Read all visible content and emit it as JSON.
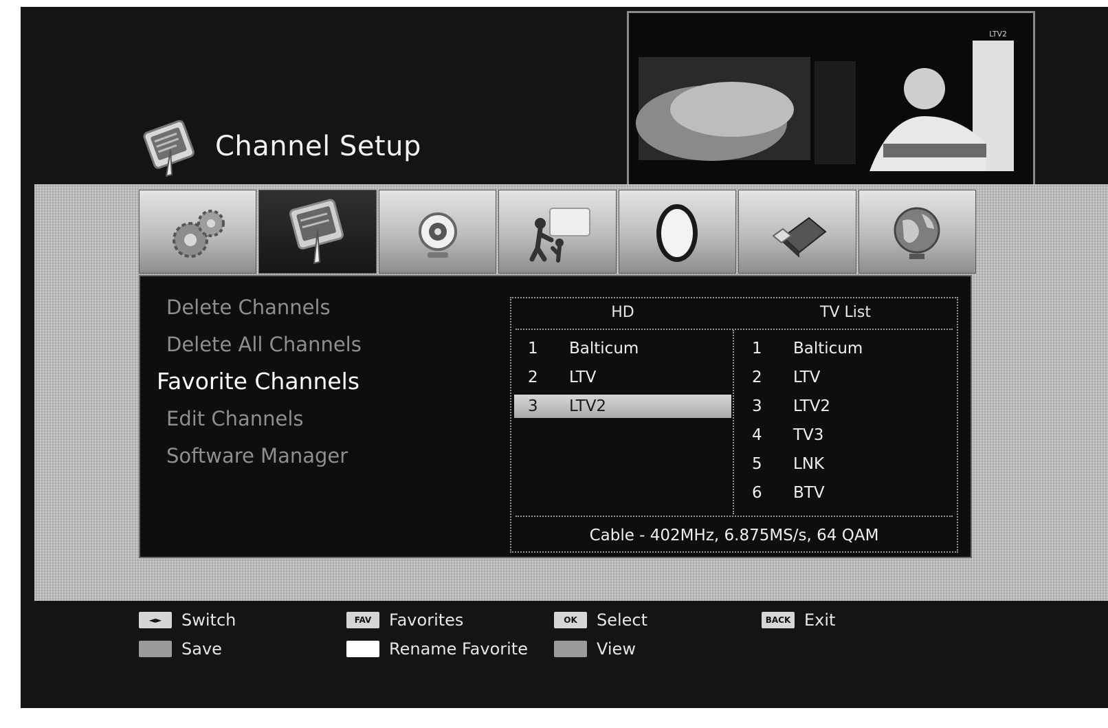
{
  "header": {
    "title": "Channel Setup",
    "title_icon": "channel-setup-icon"
  },
  "preview": {
    "caption": "LTV2"
  },
  "tabs": [
    {
      "icon": "settings-gears-icon",
      "active": false
    },
    {
      "icon": "channel-setup-icon",
      "active": true
    },
    {
      "icon": "webcam-icon",
      "active": false
    },
    {
      "icon": "parental-lock-icon",
      "active": false
    },
    {
      "icon": "disc-icon",
      "active": false
    },
    {
      "icon": "usb-drive-icon",
      "active": false
    },
    {
      "icon": "globe-icon",
      "active": false
    }
  ],
  "menu": {
    "items": [
      {
        "label": "Delete Channels",
        "active": false
      },
      {
        "label": "Delete All Channels",
        "active": false
      },
      {
        "label": "Favorite Channels",
        "active": true
      },
      {
        "label": "Edit Channels",
        "active": false
      },
      {
        "label": "Software Manager",
        "active": false
      }
    ]
  },
  "channels": {
    "favorites_header": "HD",
    "list_header": "TV List",
    "favorites": [
      {
        "num": "1",
        "name": "Balticum"
      },
      {
        "num": "2",
        "name": "LTV"
      },
      {
        "num": "3",
        "name": "LTV2",
        "selected": true
      }
    ],
    "tv_list": [
      {
        "num": "1",
        "name": "Balticum"
      },
      {
        "num": "2",
        "name": "LTV"
      },
      {
        "num": "3",
        "name": "LTV2"
      },
      {
        "num": "4",
        "name": "TV3"
      },
      {
        "num": "5",
        "name": "LNK"
      },
      {
        "num": "6",
        "name": "BTV"
      }
    ],
    "status": "Cable - 402MHz,  6.875MS/s, 64 QAM"
  },
  "legend": {
    "items": [
      {
        "key": "◄►",
        "label": "Switch",
        "key_style": "light"
      },
      {
        "key": "FAV",
        "label": "Favorites",
        "key_style": "light"
      },
      {
        "key": "OK",
        "label": "Select",
        "key_style": "light"
      },
      {
        "key": "BACK",
        "label": "Exit",
        "key_style": "light"
      },
      {
        "key": "",
        "label": "Save",
        "key_style": "grey"
      },
      {
        "key": "",
        "label": "Rename Favorite",
        "key_style": "white"
      },
      {
        "key": "",
        "label": "View",
        "key_style": "grey"
      }
    ]
  }
}
